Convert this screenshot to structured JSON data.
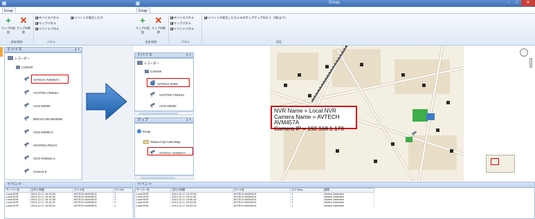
{
  "window": {
    "title": "Emap"
  },
  "left_ribbon": {
    "tab": "Emap",
    "buttons": [
      "マップの追加",
      "マップの削除"
    ],
    "checks": [
      "デバイスパネル",
      "マップパネル",
      "イベントパネル"
    ],
    "check_extra": "イベントが発生したカ",
    "groups": [
      "追加/削除",
      "パネル"
    ]
  },
  "right_ribbon": {
    "tab": "Emap",
    "buttons": [
      "マップの追加",
      "マップの削除"
    ],
    "checks": [
      "デバイスパネル",
      "マップパネル",
      "イベントパネル"
    ],
    "check_extra": "イベントが発生したカメラのポップアップを行う（3秒まで）",
    "groups": [
      "追加/削除",
      "パネル",
      "設定"
    ]
  },
  "left_device_panel": {
    "title": "デバイス",
    "pin": "‡ ×",
    "root": "レコーダー",
    "nvr": "C:ENVR",
    "cameras": [
      "AVTECH AVM457A",
      "VIVOTEK FD816A",
      "AXIS M3005",
      "BRICKCOM MD300N",
      "AXIS M3005-2",
      "VIVOTEK IP8172",
      "VIVO FD816A-2",
      "Camera 8"
    ]
  },
  "right_device_panel": {
    "title": "デバイス",
    "pin": "‡ ×",
    "root": "レコーダー",
    "nvr": "C:ENVR",
    "cameras": [
      "AVTECH AVM4",
      "VIVOTEK FD816A",
      "AXIS M3005"
    ]
  },
  "map_panel": {
    "title": "マップ",
    "pin": "‡ ×",
    "items": [
      "Emap",
      "Tainan-City-Hotel Map",
      "AVTECH AVM457A"
    ]
  },
  "info_box": {
    "line1": "NVR Name = Local NVR",
    "line2": "Camera Name = AVTECH AVM457A",
    "line3": "Camera IP = 192.168.1.173"
  },
  "left_events": {
    "title": "イベント",
    "columns": [
      "サーバー名",
      "日付と時間",
      "カメラ名",
      "カメラN"
    ],
    "rows": [
      [
        "Local NVR",
        "2014-12-17 16:16:59",
        "AVTECH AVM457A",
        "1"
      ],
      [
        "Local NVR",
        "2014-12-17 16:15:33",
        "AVTECH AVM457A",
        "1"
      ],
      [
        "Local NVR",
        "2014-12-17 16:12:38",
        "AVTECH AVM457A",
        "1"
      ],
      [
        "Local NVR",
        "2014-12-17 16:11:15",
        "AVTECH AVM457A",
        "1"
      ],
      [
        "Local NVR",
        "2014-12-17 16:05:31",
        "AVTECH AVM457A",
        "1"
      ]
    ]
  },
  "right_events": {
    "title": "イベント",
    "columns": [
      "サーバー名",
      "日付と時間",
      "カメラ名",
      "カメラNo.",
      "説明"
    ],
    "rows": [
      [
        "Local NVR",
        "2014-12-17 16:13:28",
        "AVTECH AVM457A",
        "1",
        "Motion Detection"
      ],
      [
        "Local NVR",
        "2014-12-17 16:11:45",
        "AVTECH AVM457A",
        "1",
        "Motion Detection"
      ],
      [
        "Local NVR",
        "2014-12-17 16:06:18",
        "AVTECH AVM457A",
        "1",
        "Motion Detection"
      ],
      [
        "Local NVR",
        "2014-12-17 16:04:35",
        "AVTECH AVM457A",
        "1",
        "Motion Detection"
      ],
      [
        "Local NVR",
        "2014-12-17 16:03:13",
        "AVTECH AVM457A",
        "1",
        "Motion Detection"
      ]
    ]
  },
  "colors": {
    "accent_red": "#e00000",
    "arrow_blue": "#2a6fb8",
    "titlebar": "#4a7cc0"
  },
  "icons": [
    "add-map-icon",
    "delete-map-icon",
    "recorder-icon",
    "camera-icon",
    "globe-icon",
    "map-icon",
    "arrow-right-icon"
  ]
}
